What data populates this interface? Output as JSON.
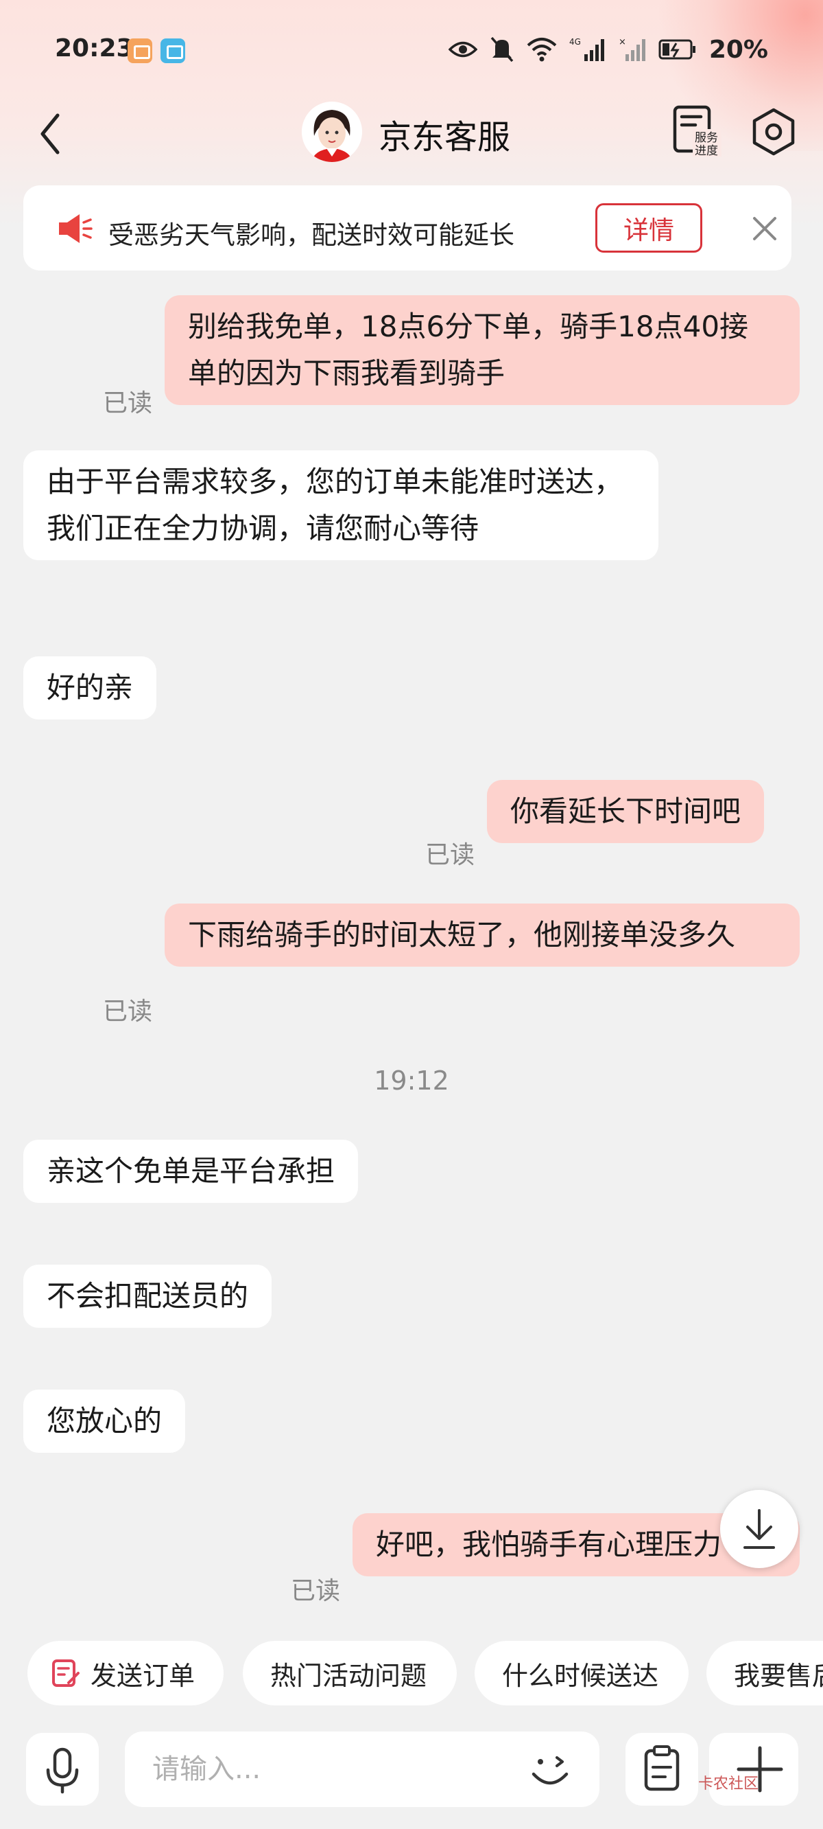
{
  "status_bar": {
    "time": "20:23",
    "battery": "20%"
  },
  "header": {
    "title": "京东客服",
    "progress_icon_label": "服务进度"
  },
  "notice": {
    "text": "受恶劣天气影响，配送时效可能延长",
    "button": "详情"
  },
  "messages": [
    {
      "side": "out",
      "text": "别给我免单，18点6分下单，骑手18点40接单的因为下雨我看到骑手",
      "status": "已读"
    },
    {
      "side": "in",
      "text": "由于平台需求较多，您的订单未能准时送达，我们正在全力协调，请您耐心等待"
    },
    {
      "side": "in",
      "text": "好的亲"
    },
    {
      "side": "out",
      "text": "你看延长下时间吧",
      "status": "已读"
    },
    {
      "side": "out",
      "text": "下雨给骑手的时间太短了，他刚接单没多久",
      "status": "已读"
    },
    {
      "side": "in",
      "text": "亲这个免单是平台承担"
    },
    {
      "side": "in",
      "text": "不会扣配送员的"
    },
    {
      "side": "in",
      "text": "您放心的"
    },
    {
      "side": "out",
      "text": "好吧，我怕骑手有心理压力",
      "status": "已读"
    }
  ],
  "timestamp": "19:12",
  "quick_replies": [
    "发送订单",
    "热门活动问题",
    "什么时候送达",
    "我要售后"
  ],
  "input": {
    "placeholder": "请输入..."
  },
  "watermark": "卡农社区",
  "colors": {
    "accent": "#d8333a",
    "outgoing_bubble": "#fdd2cd",
    "incoming_bubble": "#ffffff",
    "background": "#f1f1f1"
  },
  "icons": [
    "back-icon",
    "service-progress-icon",
    "settings-icon",
    "speaker-icon",
    "close-icon",
    "scroll-down-icon",
    "order-icon",
    "mic-icon",
    "emoji-icon",
    "clipboard-icon",
    "plus-icon"
  ]
}
